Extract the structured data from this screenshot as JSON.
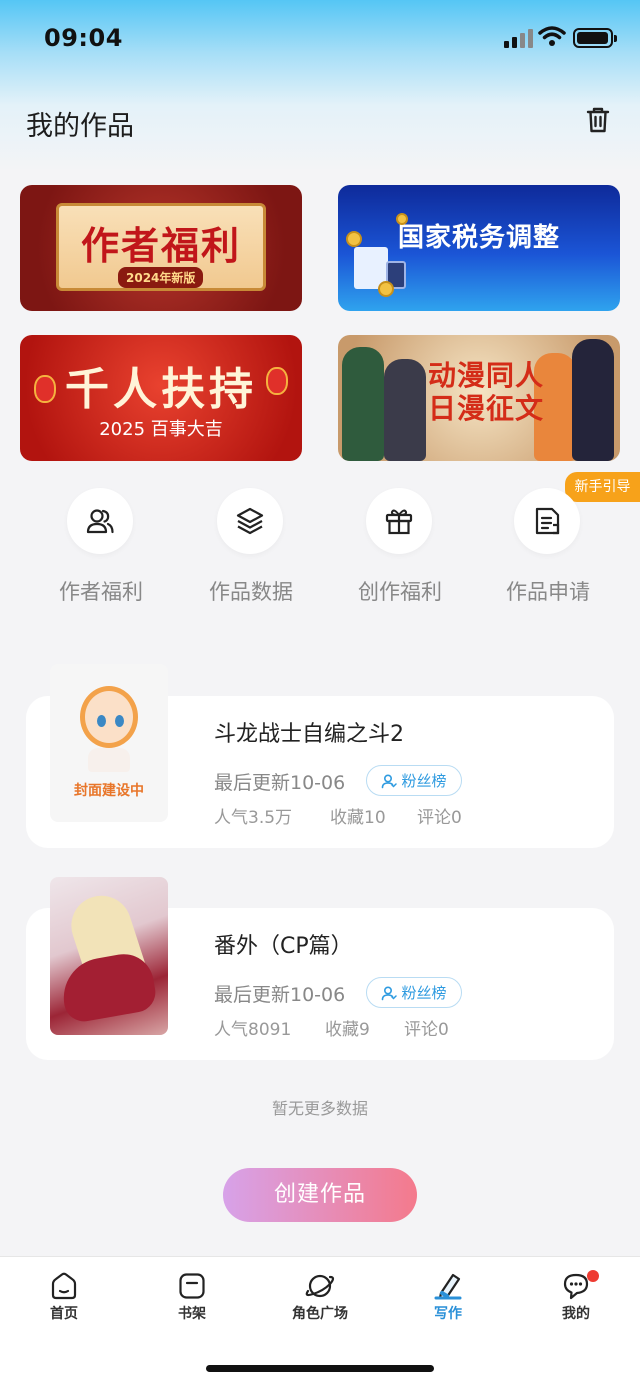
{
  "status": {
    "time": "09:04"
  },
  "header": {
    "title": "我的作品"
  },
  "banners": [
    {
      "title": "作者福利",
      "subtitle": "2024年新版"
    },
    {
      "title": "国家税务调整"
    },
    {
      "title": "千人扶持",
      "subtitle": "2025 百事大吉"
    },
    {
      "title_line1": "动漫同人",
      "title_line2": "日漫征文"
    }
  ],
  "newbie_tag": "新手引导",
  "quick_actions": [
    {
      "label": "作者福利",
      "icon": "users-icon"
    },
    {
      "label": "作品数据",
      "icon": "layers-icon"
    },
    {
      "label": "创作福利",
      "icon": "gift-icon"
    },
    {
      "label": "作品申请",
      "icon": "document-icon"
    }
  ],
  "works": [
    {
      "title": "斗龙战士自编之斗2",
      "cover_text": "封面建设中",
      "updated": "最后更新10-06",
      "fans_label": "粉丝榜",
      "popularity": "人气3.5万",
      "favorites": "收藏10",
      "comments": "评论0"
    },
    {
      "title": "番外（CP篇）",
      "updated": "最后更新10-06",
      "fans_label": "粉丝榜",
      "popularity": "人气8091",
      "favorites": "收藏9",
      "comments": "评论0"
    }
  ],
  "no_more": "暂无更多数据",
  "create_button": "创建作品",
  "tabs": [
    {
      "label": "首页",
      "icon": "home-icon"
    },
    {
      "label": "书架",
      "icon": "bookshelf-icon"
    },
    {
      "label": "角色广场",
      "icon": "planet-icon"
    },
    {
      "label": "写作",
      "icon": "pen-icon",
      "active": true
    },
    {
      "label": "我的",
      "icon": "message-icon"
    }
  ],
  "colors": {
    "accent": "#2a90d8",
    "badge": "#f7a21a",
    "notification": "#ee3b32"
  }
}
